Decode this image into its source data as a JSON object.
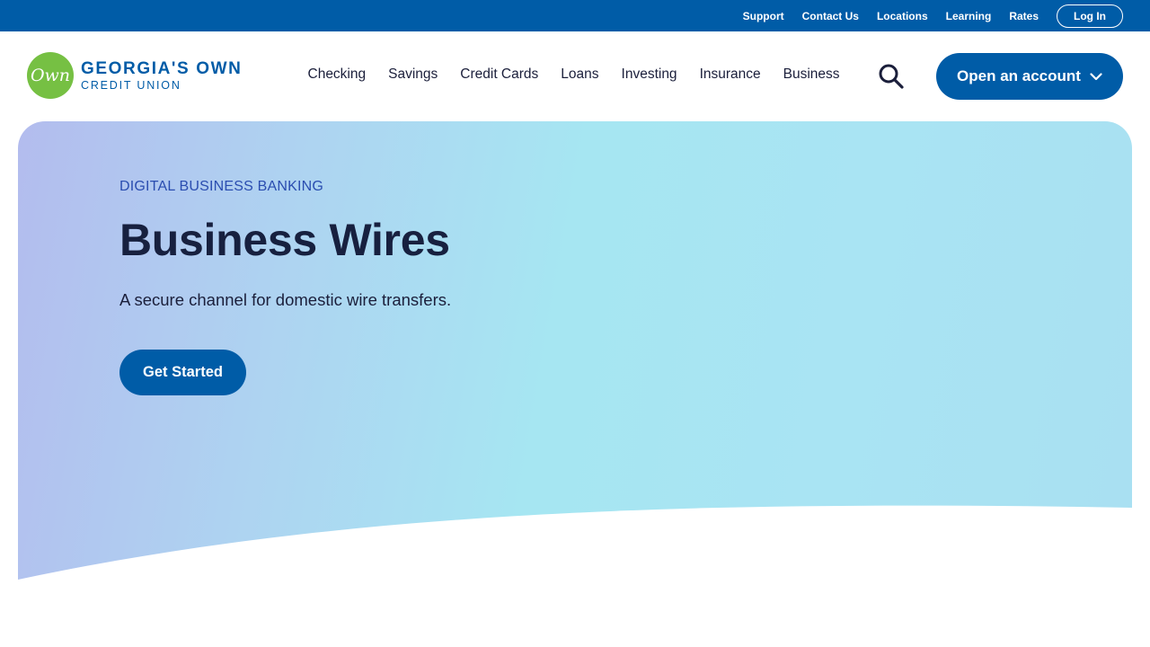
{
  "utility_nav": {
    "links": [
      "Support",
      "Contact Us",
      "Locations",
      "Learning",
      "Rates"
    ],
    "login_label": "Log In"
  },
  "brand": {
    "badge_text": "Own",
    "name": "GEORGIA'S OWN",
    "subtitle": "CREDIT UNION"
  },
  "main_nav": {
    "items": [
      "Checking",
      "Savings",
      "Credit Cards",
      "Loans",
      "Investing",
      "Insurance",
      "Business"
    ],
    "search_icon": "search-icon",
    "open_account_label": "Open an account",
    "open_account_icon": "chevron-down-icon"
  },
  "hero": {
    "eyebrow": "DIGITAL BUSINESS BANKING",
    "title": "Business Wires",
    "subtitle": "A secure channel for domestic wire transfers.",
    "cta_label": "Get Started"
  },
  "colors": {
    "primary_blue": "#005ca7",
    "brand_green": "#76c043",
    "heading_text": "#17203f",
    "eyebrow_text": "#2a4db0"
  }
}
